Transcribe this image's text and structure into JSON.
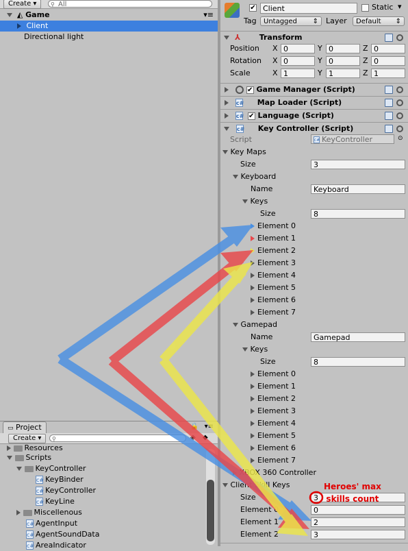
{
  "hierarchy": {
    "create_label": "Create",
    "search_placeholder": "All",
    "scene_name": "Game",
    "items": [
      {
        "label": "Client",
        "selected": true
      },
      {
        "label": "Directional light",
        "selected": false
      }
    ]
  },
  "project": {
    "tab_label": "Project",
    "create_label": "Create",
    "tree": [
      {
        "label": "Resources",
        "kind": "folder"
      },
      {
        "label": "Scripts",
        "kind": "folder"
      },
      {
        "label": "KeyController",
        "kind": "folder"
      },
      {
        "label": "KeyBinder",
        "kind": "script"
      },
      {
        "label": "KeyController",
        "kind": "script"
      },
      {
        "label": "KeyLine",
        "kind": "script"
      },
      {
        "label": "Miscellenous",
        "kind": "folder"
      },
      {
        "label": "AgentInput",
        "kind": "script"
      },
      {
        "label": "AgentSoundData",
        "kind": "script"
      },
      {
        "label": "AreaIndicator",
        "kind": "script"
      }
    ]
  },
  "inspector": {
    "object_name": "Client",
    "static_label": "Static",
    "tag_label": "Tag",
    "tag_value": "Untagged",
    "layer_label": "Layer",
    "layer_value": "Default",
    "transform": {
      "title": "Transform",
      "rows": [
        {
          "label": "Position",
          "x": "0",
          "y": "0",
          "z": "0"
        },
        {
          "label": "Rotation",
          "x": "0",
          "y": "0",
          "z": "0"
        },
        {
          "label": "Scale",
          "x": "1",
          "y": "1",
          "z": "1"
        }
      ],
      "axis_x": "X",
      "axis_y": "Y",
      "axis_z": "Z"
    },
    "components": [
      {
        "title": "Game Manager (Script)"
      },
      {
        "title": "Map Loader (Script)"
      },
      {
        "title": "Language (Script)"
      },
      {
        "title": "Key Controller (Script)"
      }
    ],
    "key_controller": {
      "script_label": "Script",
      "script_value": "KeyController",
      "key_maps_label": "Key Maps",
      "size_label": "Size",
      "key_maps_size": "3",
      "keyboard_label": "Keyboard",
      "name_label": "Name",
      "keyboard_name": "Keyboard",
      "keys_label": "Keys",
      "keyboard_keys_size": "8",
      "keyboard_elements": [
        "Element 0",
        "Element 1",
        "Element 2",
        "Element 3",
        "Element 4",
        "Element 5",
        "Element 6",
        "Element 7"
      ],
      "gamepad_label": "Gamepad",
      "gamepad_name": "Gamepad",
      "gamepad_keys_size": "8",
      "gamepad_elements": [
        "Element 0",
        "Element 1",
        "Element 2",
        "Element 3",
        "Element 4",
        "Element 5",
        "Element 6",
        "Element 7"
      ],
      "xbox_label": "XBOX 360 Controller",
      "client_skill_keys_label": "Client Skill Keys",
      "client_size": "3",
      "client_elements": [
        {
          "label": "Element 0",
          "value": "0"
        },
        {
          "label": "Element 1",
          "value": "2"
        },
        {
          "label": "Element 2",
          "value": "3"
        }
      ]
    },
    "annotation": [
      "Heroes' max",
      "skills count"
    ]
  },
  "colors": {
    "arrow_blue": "#4a90e2",
    "arrow_red": "#e8474a",
    "arrow_yellow": "#ece64a",
    "selection": "#3d80df",
    "annotation_red": "#e10000"
  }
}
